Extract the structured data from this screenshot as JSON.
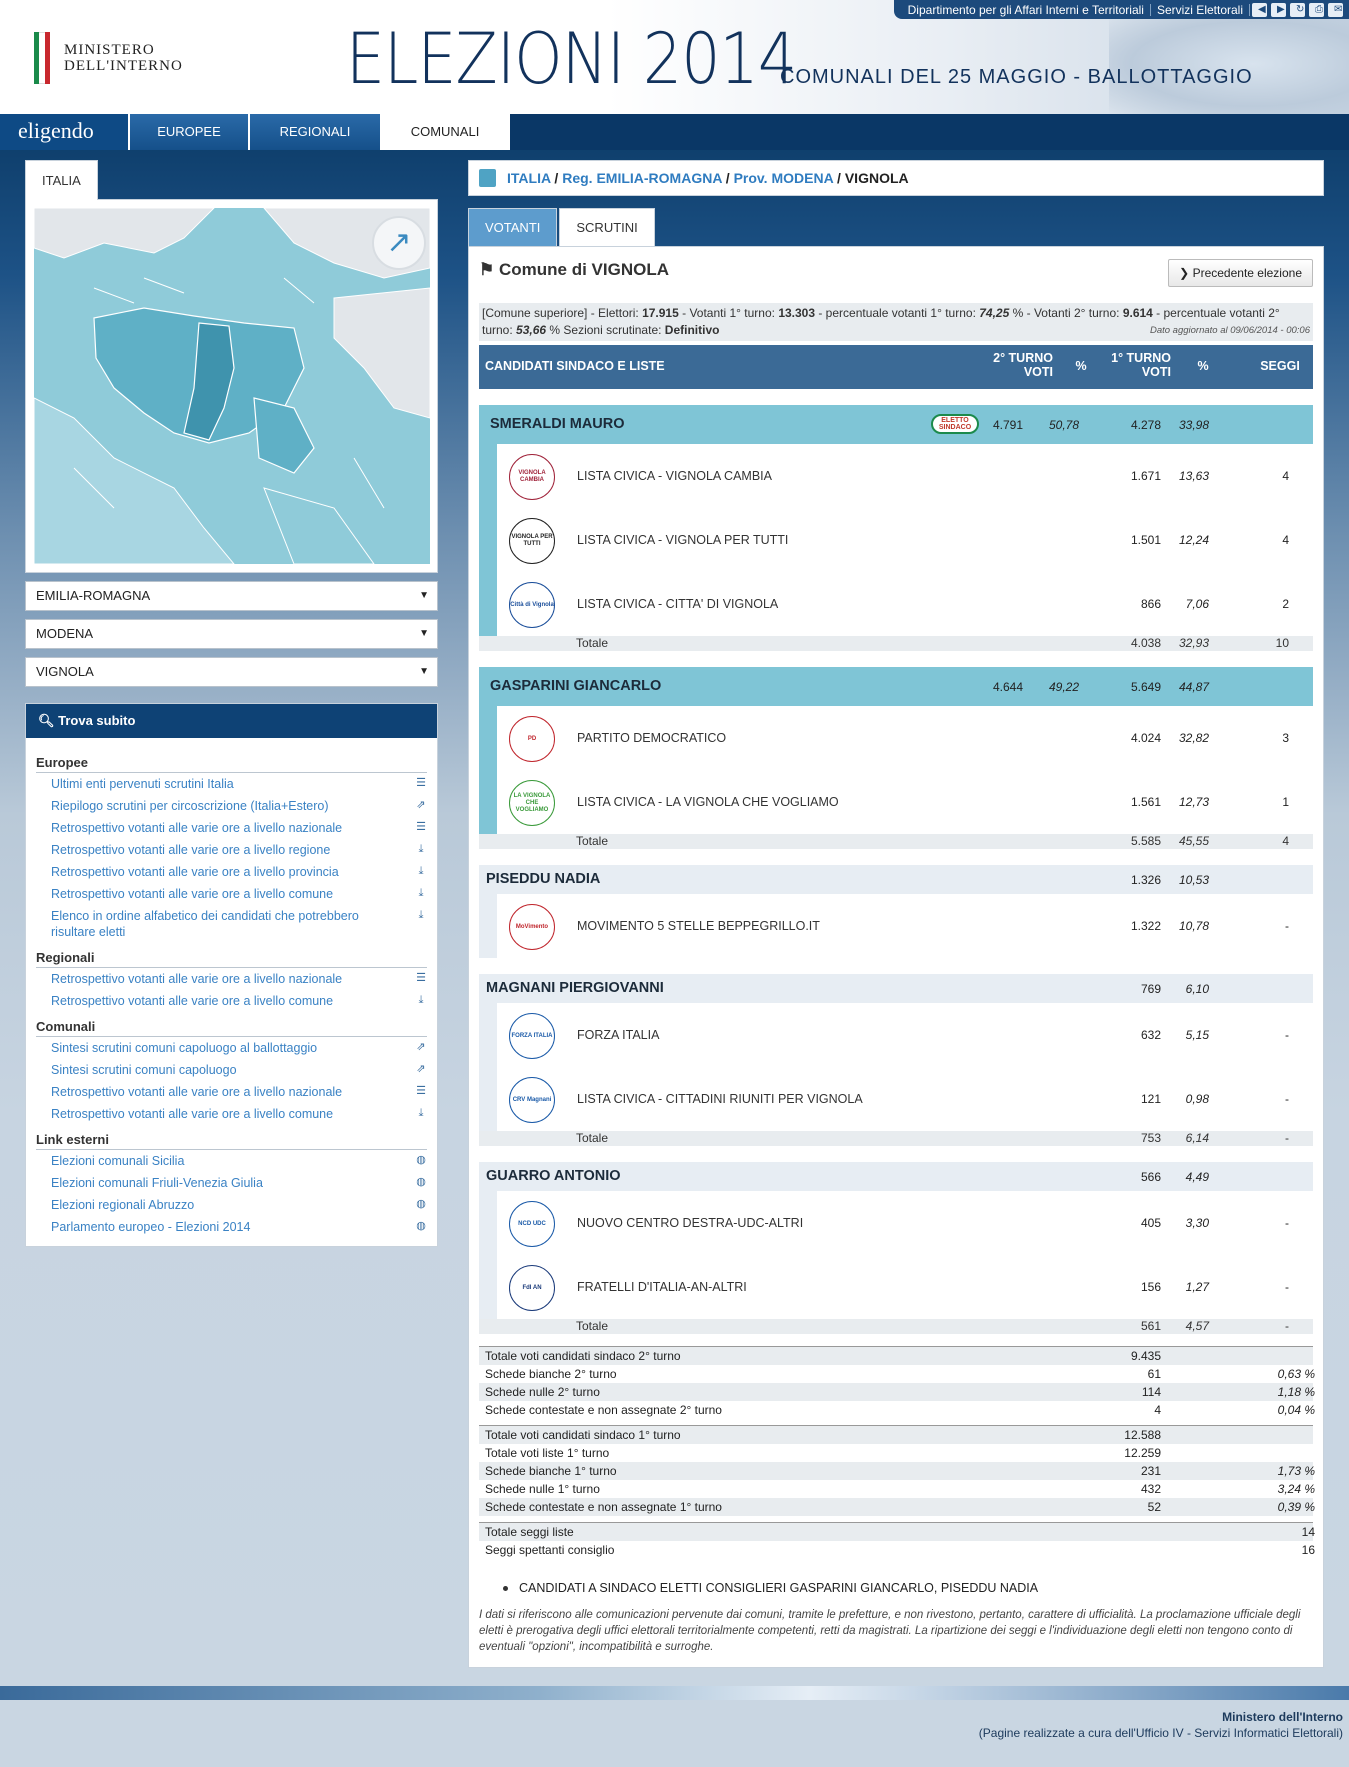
{
  "topbar": {
    "link1": "Dipartimento per gli Affari Interni e Territoriali",
    "link2": "Servizi Elettorali",
    "icons": [
      "arrow-left-icon",
      "arrow-right-icon",
      "refresh-icon",
      "print-icon",
      "mail-icon"
    ]
  },
  "header": {
    "ministry_line1": "MINISTERO",
    "ministry_line2": "DELL'INTERNO",
    "title": "ELEZIONI 2014",
    "subtitle": "COMUNALI DEL 25 MAGGIO - BALLOTTAGGIO",
    "flag_colors": [
      "#1a8a4a",
      "#ffffff",
      "#c8282e"
    ]
  },
  "nav": {
    "brand": "eligendo",
    "tabs": [
      "EUROPEE",
      "REGIONALI",
      "COMUNALI"
    ],
    "active": "COMUNALI"
  },
  "left": {
    "tab": "ITALIA",
    "selects": [
      "EMILIA-ROMAGNA",
      "MODENA",
      "VIGNOLA"
    ],
    "trova_title": "Trova subito",
    "groups": [
      {
        "title": "Europee",
        "links": [
          {
            "text": "Ultimi enti pervenuti scrutini Italia",
            "icon": "list-icon"
          },
          {
            "text": "Riepilogo scrutini per circoscrizione (Italia+Estero)",
            "icon": "external-icon"
          },
          {
            "text": "Retrospettivo votanti alle varie ore a livello nazionale",
            "icon": "list-icon"
          },
          {
            "text": "Retrospettivo votanti alle varie ore a livello regione",
            "icon": "download-icon"
          },
          {
            "text": "Retrospettivo votanti alle varie ore a livello provincia",
            "icon": "download-icon"
          },
          {
            "text": "Retrospettivo votanti alle varie ore a livello comune",
            "icon": "download-icon"
          },
          {
            "text": "Elenco in ordine alfabetico dei candidati che potrebbero risultare eletti",
            "icon": "download-icon"
          }
        ]
      },
      {
        "title": "Regionali",
        "links": [
          {
            "text": "Retrospettivo votanti alle varie ore a livello nazionale",
            "icon": "list-icon"
          },
          {
            "text": "Retrospettivo votanti alle varie ore a livello comune",
            "icon": "download-icon"
          }
        ]
      },
      {
        "title": "Comunali",
        "links": [
          {
            "text": "Sintesi scrutini comuni capoluogo al ballottaggio",
            "icon": "external-icon"
          },
          {
            "text": "Sintesi scrutini comuni capoluogo",
            "icon": "external-icon"
          },
          {
            "text": "Retrospettivo votanti alle varie ore a livello nazionale",
            "icon": "list-icon"
          },
          {
            "text": "Retrospettivo votanti alle varie ore a livello comune",
            "icon": "download-icon"
          }
        ]
      },
      {
        "title": "Link esterni",
        "links": [
          {
            "text": "Elezioni comunali Sicilia",
            "icon": "globe-icon"
          },
          {
            "text": "Elezioni comunali Friuli-Venezia Giulia",
            "icon": "globe-icon"
          },
          {
            "text": "Elezioni regionali Abruzzo",
            "icon": "globe-icon"
          },
          {
            "text": "Parlamento europeo - Elezioni 2014",
            "icon": "globe-icon"
          }
        ]
      }
    ]
  },
  "breadcrumb": {
    "items": [
      "ITALIA",
      "Reg. EMILIA-ROMAGNA",
      "Prov. MODENA"
    ],
    "current": "VIGNOLA",
    "sep": " / "
  },
  "tabs": [
    "VOTANTI",
    "SCRUTINI"
  ],
  "active_tab": "SCRUTINI",
  "comune_title": "Comune di VIGNOLA",
  "prev_button": "Precedente elezione",
  "info": {
    "p1": "[Comune superiore] - Elettori: ",
    "elettori": "17.915",
    "p2": " - Votanti 1° turno: ",
    "votanti1": "13.303",
    "p3": " - percentuale votanti 1° turno: ",
    "perc1": "74,25",
    "p4": " % - Votanti 2° turno: ",
    "votanti2": "9.614",
    "p5": " - percentuale votanti 2° turno: ",
    "perc2": "53,66",
    "p6": " % Sezioni scrutinate: ",
    "sezioni": "Definitivo",
    "updated": "Dato aggiornato al 09/06/2014 - 00:06"
  },
  "table_header": {
    "col_name": "CANDIDATI SINDACO E LISTE",
    "col_v2": "2° TURNO VOTI",
    "col_p2": "%",
    "col_v1": "1° TURNO VOTI",
    "col_p1": "%",
    "col_seggi": "SEGGI"
  },
  "elected_badge": "ELETTO SINDACO",
  "total_label": "Totale",
  "candidates": [
    {
      "name": "SMERALDI MAURO",
      "ballot": true,
      "elected": true,
      "v2": "4.791",
      "p2": "50,78",
      "v1": "4.278",
      "p1": "33,98",
      "lists": [
        {
          "name": "LISTA CIVICA - VIGNOLA CAMBIA",
          "logo": "VIGNOLA CAMBIA",
          "v": "1.671",
          "p": "13,63",
          "s": "4",
          "color": "#a0233a"
        },
        {
          "name": "LISTA CIVICA - VIGNOLA PER TUTTI",
          "logo": "VIGNOLA PER TUTTI",
          "v": "1.501",
          "p": "12,24",
          "s": "4",
          "color": "#222222"
        },
        {
          "name": "LISTA CIVICA - CITTA' DI VIGNOLA",
          "logo": "Città di Vignola",
          "v": "866",
          "p": "7,06",
          "s": "2",
          "color": "#1a4e9a"
        }
      ],
      "total": {
        "v": "4.038",
        "p": "32,93",
        "s": "10"
      }
    },
    {
      "name": "GASPARINI GIANCARLO",
      "ballot": true,
      "elected": false,
      "v2": "4.644",
      "p2": "49,22",
      "v1": "5.649",
      "p1": "44,87",
      "lists": [
        {
          "name": "PARTITO DEMOCRATICO",
          "logo": "PD",
          "v": "4.024",
          "p": "32,82",
          "s": "3",
          "color": "#c0262d"
        },
        {
          "name": "LISTA CIVICA - LA VIGNOLA CHE VOGLIAMO",
          "logo": "LA VIGNOLA CHE VOGLIAMO",
          "v": "1.561",
          "p": "12,73",
          "s": "1",
          "color": "#3a9a3a"
        }
      ],
      "total": {
        "v": "5.585",
        "p": "45,55",
        "s": "4"
      }
    },
    {
      "name": "PISEDDU NADIA",
      "ballot": false,
      "elected": false,
      "v2": "",
      "p2": "",
      "v1": "1.326",
      "p1": "10,53",
      "lists": [
        {
          "name": "MOVIMENTO 5 STELLE BEPPEGRILLO.IT",
          "logo": "MoVimento",
          "v": "1.322",
          "p": "10,78",
          "s": "-",
          "color": "#c0262d"
        }
      ],
      "total": null
    },
    {
      "name": "MAGNANI PIERGIOVANNI",
      "ballot": false,
      "elected": false,
      "v2": "",
      "p2": "",
      "v1": "769",
      "p1": "6,10",
      "lists": [
        {
          "name": "FORZA ITALIA",
          "logo": "FORZA ITALIA",
          "v": "632",
          "p": "5,15",
          "s": "-",
          "color": "#1a5aa8"
        },
        {
          "name": "LISTA CIVICA - CITTADINI RIUNITI PER VIGNOLA",
          "logo": "CRV Magnani",
          "v": "121",
          "p": "0,98",
          "s": "-",
          "color": "#1a5aa8"
        }
      ],
      "total": {
        "v": "753",
        "p": "6,14",
        "s": "-"
      }
    },
    {
      "name": "GUARRO ANTONIO",
      "ballot": false,
      "elected": false,
      "v2": "",
      "p2": "",
      "v1": "566",
      "p1": "4,49",
      "lists": [
        {
          "name": "NUOVO CENTRO DESTRA-UDC-ALTRI",
          "logo": "NCD UDC",
          "v": "405",
          "p": "3,30",
          "s": "-",
          "color": "#1a5aa8"
        },
        {
          "name": "FRATELLI D'ITALIA-AN-ALTRI",
          "logo": "FdI AN",
          "v": "156",
          "p": "1,27",
          "s": "-",
          "color": "#1a3a7a"
        }
      ],
      "total": {
        "v": "561",
        "p": "4,57",
        "s": "-"
      }
    }
  ],
  "summary": [
    [
      {
        "label": "Totale voti candidati sindaco 2° turno",
        "v": "9.435",
        "p": ""
      },
      {
        "label": "Schede bianche 2° turno",
        "v": "61",
        "p": "0,63 %"
      },
      {
        "label": "Schede nulle 2° turno",
        "v": "114",
        "p": "1,18 %"
      },
      {
        "label": "Schede contestate e non assegnate 2° turno",
        "v": "4",
        "p": "0,04 %"
      }
    ],
    [
      {
        "label": "Totale voti candidati sindaco 1° turno",
        "v": "12.588",
        "p": ""
      },
      {
        "label": "Totale voti liste 1° turno",
        "v": "12.259",
        "p": ""
      },
      {
        "label": "Schede bianche 1° turno",
        "v": "231",
        "p": "1,73 %"
      },
      {
        "label": "Schede nulle 1° turno",
        "v": "432",
        "p": "3,24 %"
      },
      {
        "label": "Schede contestate e non assegnate 1° turno",
        "v": "52",
        "p": "0,39 %"
      }
    ],
    [
      {
        "label": "Totale seggi liste",
        "v": "",
        "p": "14"
      },
      {
        "label": "Seggi spettanti consiglio",
        "v": "",
        "p": "16"
      }
    ]
  ],
  "note": "CANDIDATI A SINDACO ELETTI CONSIGLIERI GASPARINI GIANCARLO, PISEDDU NADIA",
  "disclaimer": "I dati si riferiscono alle comunicazioni pervenute dai comuni, tramite le prefetture, e non rivestono, pertanto, carattere di ufficialità. La proclamazione ufficiale degli eletti è prerogativa degli uffici elettorali territorialmente competenti, retti da magistrati. La ripartizione dei seggi e l'individuazione degli eletti non tengono conto di eventuali \"opzioni\", incompatibilità e surroghe.",
  "footer": {
    "line1": "Ministero dell'Interno",
    "line2": "(Pagine realizzate a cura dell'Ufficio IV - Servizi Informatici Elettorali)"
  },
  "colors": {
    "accent": "#0e4275",
    "candidate_bg": "#7fc5d6",
    "link": "#3a82c4"
  }
}
